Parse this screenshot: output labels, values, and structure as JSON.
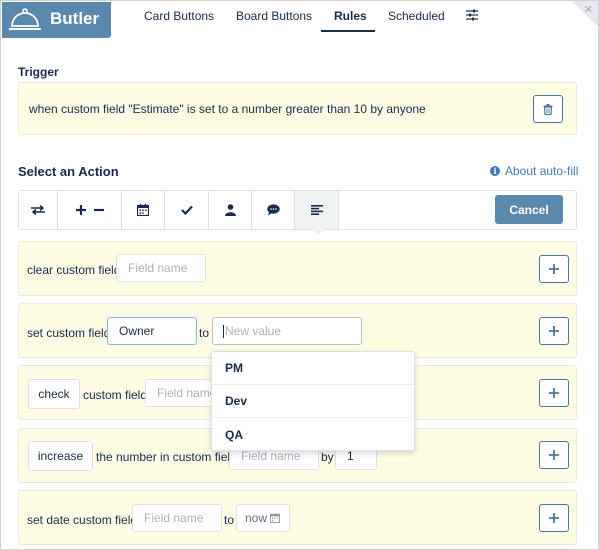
{
  "header": {
    "brand": "Butler",
    "tabs": [
      {
        "label": "Card Buttons"
      },
      {
        "label": "Board Buttons"
      },
      {
        "label": "Rules"
      },
      {
        "label": "Scheduled"
      }
    ],
    "active_tab": "Rules"
  },
  "trigger": {
    "label": "Trigger",
    "text": "when custom field \"Estimate\" is set to a number greater than 10 by anyone"
  },
  "action_section": {
    "label": "Select an Action",
    "about_link": "About auto-fill",
    "cancel_label": "Cancel",
    "toolbar_icons": [
      "move-icon",
      "plus-minus-icon",
      "calendar-icon",
      "check-icon",
      "member-icon",
      "comment-icon",
      "fields-icon"
    ],
    "selected_icon": "fields-icon"
  },
  "rows": {
    "clear": {
      "label": "clear custom field",
      "placeholder": "Field name"
    },
    "set": {
      "label": "set custom field",
      "field_value": "Owner",
      "to_label": "to",
      "new_value_placeholder": "New value"
    },
    "check": {
      "button": "check",
      "label": "custom field",
      "placeholder": "Field name"
    },
    "increase": {
      "button": "increase",
      "label": "the number in custom field",
      "placeholder": "Field name",
      "by_label": "by",
      "amount": "1"
    },
    "set_date": {
      "label": "set date custom field",
      "placeholder": "Field name",
      "to_label": "to",
      "date_value": "now"
    }
  },
  "dropdown": {
    "options": [
      "PM",
      "Dev",
      "QA"
    ]
  },
  "colors": {
    "brand": "#5b88ad",
    "highlight": "#fdfce3",
    "link": "#3c7ab8"
  }
}
